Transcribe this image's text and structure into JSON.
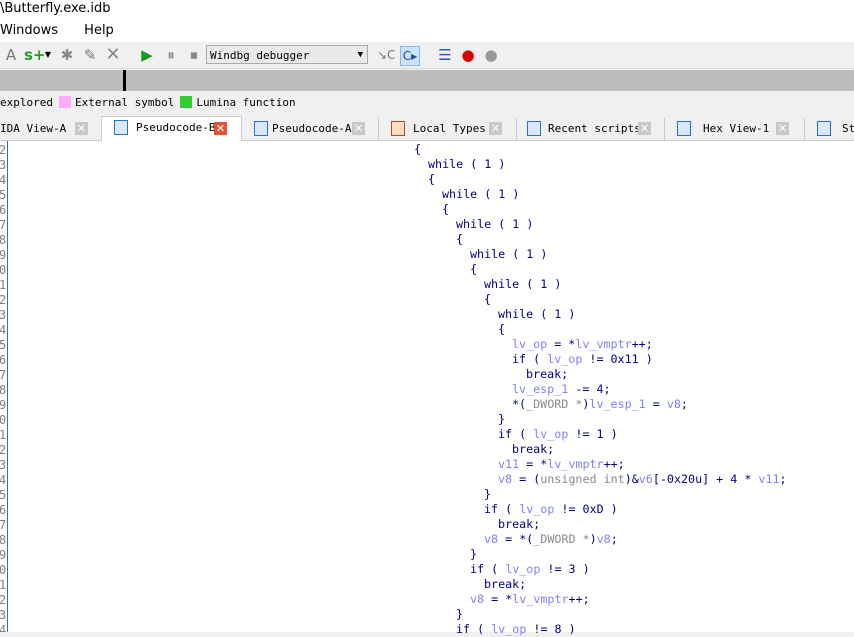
{
  "title": "\\Butterfly.exe.idb",
  "menu": [
    "Windows",
    "Help"
  ],
  "toolbar": {
    "debugger_select": "Windbg debugger",
    "icons": [
      "add-struct-icon",
      "add-enum-icon",
      "chevron-down-icon",
      "asterisk-icon",
      "edit-icon",
      "delete-icon",
      "play-icon",
      "pause-icon",
      "stop-icon",
      "step-into-icon",
      "run-to-cursor-icon",
      "breakpoint-list-icon",
      "add-breakpoint-icon",
      "delete-breakpoint-icon"
    ]
  },
  "legend": [
    {
      "label": "explored",
      "color": null
    },
    {
      "label": "External symbol",
      "color": "#ffaaff"
    },
    {
      "label": "Lumina function",
      "color": "#33cc33"
    }
  ],
  "tabs": [
    {
      "label": "IDA View-A",
      "active": false
    },
    {
      "label": "Pseudocode-B",
      "active": true
    },
    {
      "label": "Pseudocode-A",
      "active": false
    },
    {
      "label": "Local Types",
      "active": false
    },
    {
      "label": "Recent scripts",
      "active": false
    },
    {
      "label": "Hex View-1",
      "active": false
    },
    {
      "label": "St",
      "active": false
    }
  ],
  "line_numbers": [
    "2",
    "3",
    "4",
    "5",
    "6",
    "7",
    "8",
    "9",
    "0",
    "1",
    "2",
    "3",
    "4",
    "5",
    "6",
    "7",
    "8",
    "9",
    "0",
    "1",
    "2",
    "3",
    "4",
    "5",
    "6",
    "7",
    "8",
    "9",
    "0",
    "1",
    "2",
    "3",
    "4"
  ],
  "code": [
    {
      "i": 0,
      "t": [
        [
          "k",
          "{"
        ]
      ]
    },
    {
      "i": 2,
      "t": [
        [
          "k",
          "while ( 1 )"
        ]
      ]
    },
    {
      "i": 2,
      "t": [
        [
          "k",
          "{"
        ]
      ]
    },
    {
      "i": 4,
      "t": [
        [
          "k",
          "while ( 1 )"
        ]
      ]
    },
    {
      "i": 4,
      "t": [
        [
          "k",
          "{"
        ]
      ]
    },
    {
      "i": 6,
      "t": [
        [
          "k",
          "while ( 1 )"
        ]
      ]
    },
    {
      "i": 6,
      "t": [
        [
          "k",
          "{"
        ]
      ]
    },
    {
      "i": 8,
      "t": [
        [
          "k",
          "while ( 1 )"
        ]
      ]
    },
    {
      "i": 8,
      "t": [
        [
          "k",
          "{"
        ]
      ]
    },
    {
      "i": 10,
      "t": [
        [
          "k",
          "while ( 1 )"
        ]
      ]
    },
    {
      "i": 10,
      "t": [
        [
          "k",
          "{"
        ]
      ]
    },
    {
      "i": 12,
      "t": [
        [
          "k",
          "while ( 1 )"
        ]
      ]
    },
    {
      "i": 12,
      "t": [
        [
          "k",
          "{"
        ]
      ]
    },
    {
      "i": 14,
      "t": [
        [
          "v",
          "lv_op"
        ],
        [
          "k",
          " = *"
        ],
        [
          "v",
          "lv_vmptr"
        ],
        [
          "k",
          "++;"
        ]
      ]
    },
    {
      "i": 14,
      "t": [
        [
          "k",
          "if ( "
        ],
        [
          "v",
          "lv_op"
        ],
        [
          "k",
          " != 0x11 )"
        ]
      ]
    },
    {
      "i": 16,
      "t": [
        [
          "k",
          "break;"
        ]
      ]
    },
    {
      "i": 14,
      "t": [
        [
          "v",
          "lv_esp_1"
        ],
        [
          "k",
          " -= 4;"
        ]
      ]
    },
    {
      "i": 14,
      "t": [
        [
          "k",
          "*("
        ],
        [
          "t",
          "_DWORD *"
        ],
        [
          "k",
          ")"
        ],
        [
          "v",
          "lv_esp_1"
        ],
        [
          "k",
          " = "
        ],
        [
          "v",
          "v8"
        ],
        [
          "k",
          ";"
        ]
      ]
    },
    {
      "i": 12,
      "t": [
        [
          "k",
          "}"
        ]
      ]
    },
    {
      "i": 12,
      "t": [
        [
          "k",
          "if ( "
        ],
        [
          "v",
          "lv_op"
        ],
        [
          "k",
          " != 1 )"
        ]
      ]
    },
    {
      "i": 14,
      "t": [
        [
          "k",
          "break;"
        ]
      ]
    },
    {
      "i": 12,
      "t": [
        [
          "v",
          "v11"
        ],
        [
          "k",
          " = *"
        ],
        [
          "v",
          "lv_vmptr"
        ],
        [
          "k",
          "++;"
        ]
      ]
    },
    {
      "i": 12,
      "t": [
        [
          "v",
          "v8"
        ],
        [
          "k",
          " = ("
        ],
        [
          "t",
          "unsigned int"
        ],
        [
          "k",
          ")&"
        ],
        [
          "v",
          "v6"
        ],
        [
          "k",
          "[-0x20u] + 4 * "
        ],
        [
          "v",
          "v11"
        ],
        [
          "k",
          ";"
        ]
      ]
    },
    {
      "i": 10,
      "t": [
        [
          "k",
          "}"
        ]
      ]
    },
    {
      "i": 10,
      "t": [
        [
          "k",
          "if ( "
        ],
        [
          "v",
          "lv_op"
        ],
        [
          "k",
          " != 0xD )"
        ]
      ]
    },
    {
      "i": 12,
      "t": [
        [
          "k",
          "break;"
        ]
      ]
    },
    {
      "i": 10,
      "t": [
        [
          "v",
          "v8"
        ],
        [
          "k",
          " = *("
        ],
        [
          "t",
          "_DWORD *"
        ],
        [
          "k",
          ")"
        ],
        [
          "v",
          "v8"
        ],
        [
          "k",
          ";"
        ]
      ]
    },
    {
      "i": 8,
      "t": [
        [
          "k",
          "}"
        ]
      ]
    },
    {
      "i": 8,
      "t": [
        [
          "k",
          "if ( "
        ],
        [
          "v",
          "lv_op"
        ],
        [
          "k",
          " != 3 )"
        ]
      ]
    },
    {
      "i": 10,
      "t": [
        [
          "k",
          "break;"
        ]
      ]
    },
    {
      "i": 8,
      "t": [
        [
          "v",
          "v8"
        ],
        [
          "k",
          " = *"
        ],
        [
          "v",
          "lv_vmptr"
        ],
        [
          "k",
          "++;"
        ]
      ]
    },
    {
      "i": 6,
      "t": [
        [
          "k",
          "}"
        ]
      ]
    },
    {
      "i": 6,
      "t": [
        [
          "k",
          "if ( "
        ],
        [
          "v",
          "lv_op"
        ],
        [
          "k",
          " != 8 )"
        ]
      ]
    }
  ]
}
